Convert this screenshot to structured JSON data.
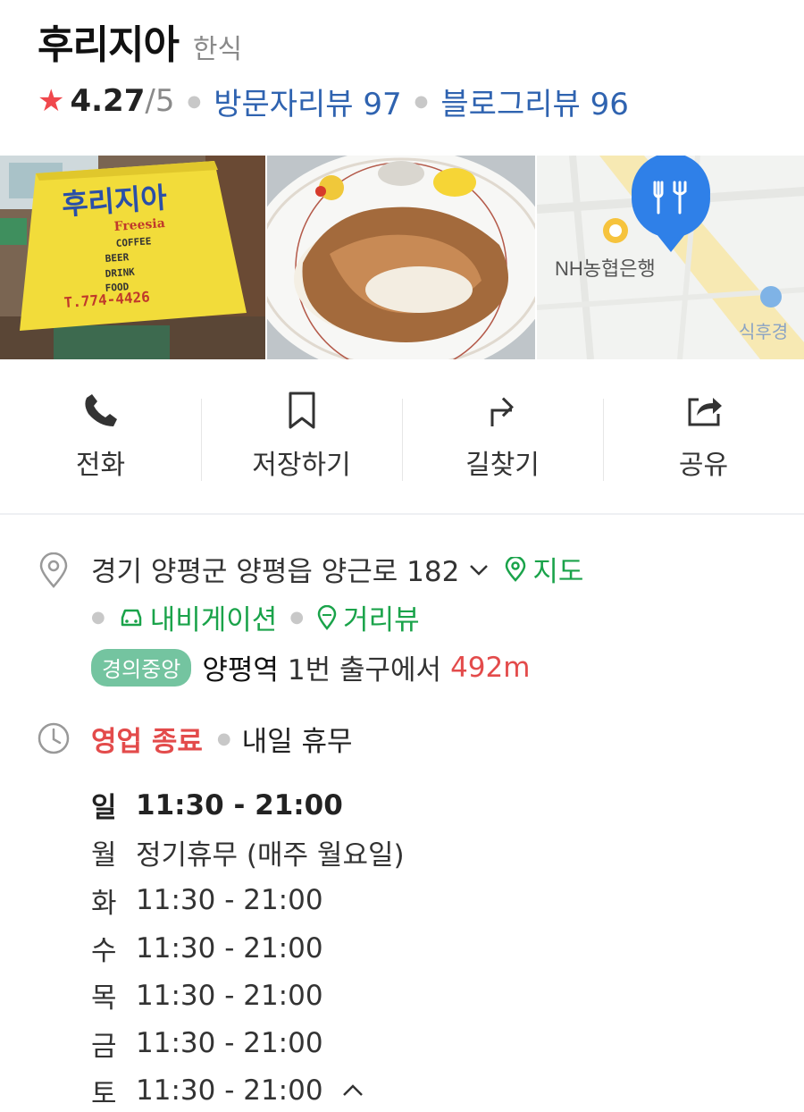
{
  "place": {
    "name": "후리지아",
    "category": "한식",
    "rating": "4.27",
    "rating_max": "/5",
    "visitor_reviews": "방문자리뷰 97",
    "blog_reviews": "블로그리뷰 96"
  },
  "photos": {
    "sign_title": "후리지아",
    "sign_sub": "Freesia",
    "sign_menu": [
      "COFFEE",
      "BEER",
      "DRINK",
      "FOOD"
    ],
    "sign_phone": "T.774-4426",
    "map_label_bank": "NH농협은행",
    "map_label_other": "식후경"
  },
  "actions": [
    {
      "label": "전화",
      "icon": "phone-icon"
    },
    {
      "label": "저장하기",
      "icon": "bookmark-icon"
    },
    {
      "label": "길찾기",
      "icon": "directions-icon"
    },
    {
      "label": "공유",
      "icon": "share-icon"
    }
  ],
  "address": {
    "text": "경기 양평군 양평읍 양근로 182",
    "map_link": "지도",
    "navigation_link": "내비게이션",
    "street_view_link": "거리뷰",
    "subway_line": "경의중앙",
    "station_text": "양평역",
    "exit_text": "1번 출구에서",
    "distance": "492m"
  },
  "hours": {
    "status": "영업 종료",
    "next": "내일 휴무",
    "days": [
      {
        "day": "일",
        "time": "11:30 - 21:00",
        "today": true
      },
      {
        "day": "월",
        "time": "정기휴무 (매주 월요일)"
      },
      {
        "day": "화",
        "time": "11:30 - 21:00"
      },
      {
        "day": "수",
        "time": "11:30 - 21:00"
      },
      {
        "day": "목",
        "time": "11:30 - 21:00"
      },
      {
        "day": "금",
        "time": "11:30 - 21:00"
      },
      {
        "day": "토",
        "time": "11:30 - 21:00"
      }
    ]
  },
  "colors": {
    "star": "#f0484d",
    "link_blue": "#2f63b0",
    "link_green": "#1aa34a",
    "closed_red": "#e34b4b",
    "subway_badge": "#74c4a0",
    "map_pin": "#2f80e8"
  }
}
